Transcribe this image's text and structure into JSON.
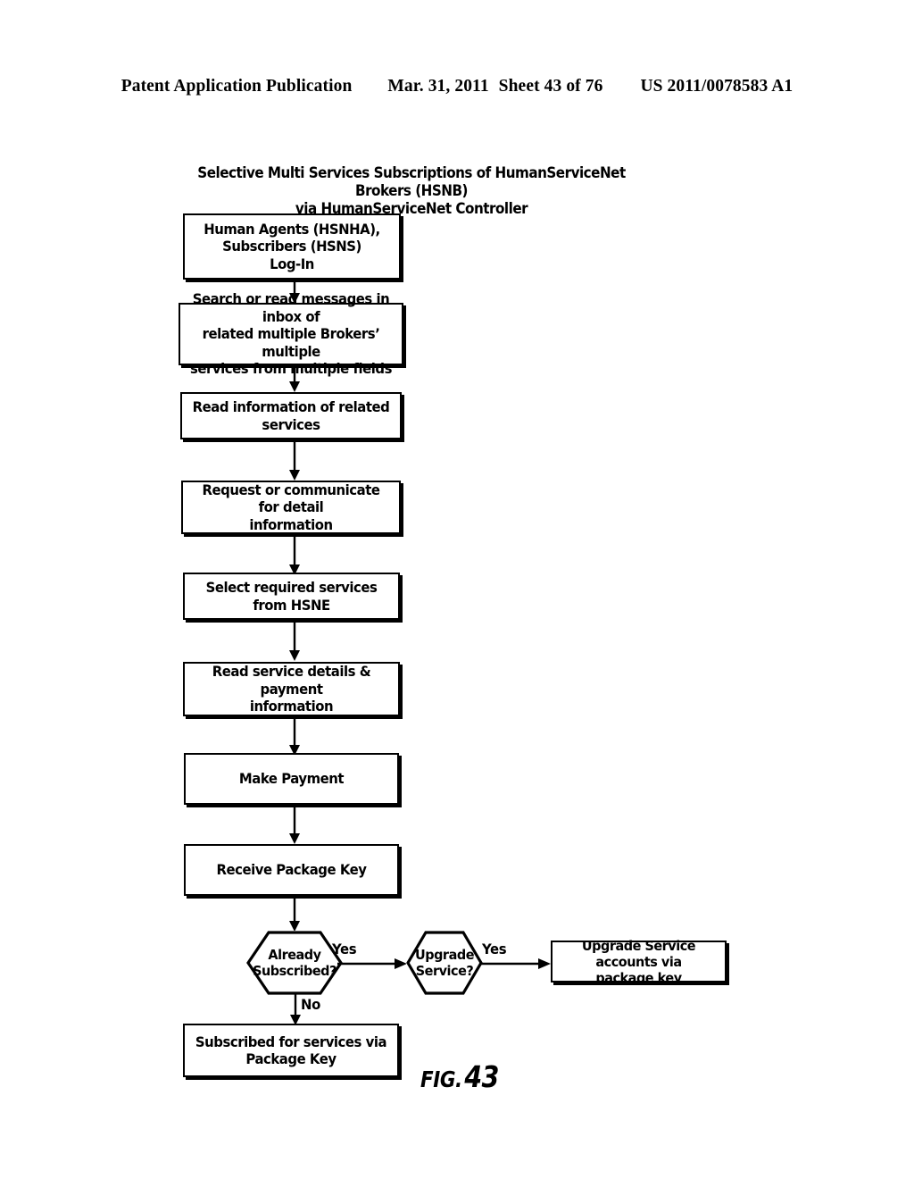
{
  "header": {
    "publication": "Patent Application Publication",
    "date": "Mar. 31, 2011",
    "sheet": "Sheet 43 of 76",
    "number": "US 2011/0078583 A1"
  },
  "figure": {
    "caption_word": "FIG.",
    "caption_number": "43",
    "title_line1": "Selective Multi Services Subscriptions of HumanServiceNet Brokers (HSNB)",
    "title_line2": "via HumanServiceNet Controller",
    "nodes": [
      {
        "id": "login",
        "type": "process",
        "lines": [
          "Human Agents (HSNHA),",
          "Subscribers (HSNS)",
          "Log-In"
        ]
      },
      {
        "id": "search-inbox",
        "type": "process",
        "lines": [
          "Search or read messages in inbox of",
          "related multiple Brokers’ multiple",
          "services from multiple fields"
        ]
      },
      {
        "id": "read-info",
        "type": "process",
        "lines": [
          "Read information of related services"
        ]
      },
      {
        "id": "request-detail",
        "type": "process",
        "lines": [
          "Request or communicate for detail",
          "information"
        ]
      },
      {
        "id": "select-services",
        "type": "process",
        "lines": [
          "Select required services from HSNE"
        ]
      },
      {
        "id": "read-payment",
        "type": "process",
        "lines": [
          "Read service details & payment",
          "information"
        ]
      },
      {
        "id": "make-payment",
        "type": "process",
        "lines": [
          "Make Payment"
        ]
      },
      {
        "id": "receive-key",
        "type": "process",
        "lines": [
          "Receive Package Key"
        ]
      },
      {
        "id": "already-subscribed",
        "type": "decision",
        "lines": [
          "Already",
          "Subscribed?"
        ]
      },
      {
        "id": "upgrade-service",
        "type": "decision",
        "lines": [
          "Upgrade",
          "Service?"
        ]
      },
      {
        "id": "upgrade-accounts",
        "type": "process",
        "lines": [
          "Upgrade Service accounts via",
          "package key"
        ]
      },
      {
        "id": "subscribed-via-key",
        "type": "process",
        "lines": [
          "Subscribed for services via",
          "Package Key"
        ]
      }
    ],
    "edge_labels": {
      "already_subscribed_yes": "Yes",
      "already_subscribed_no": "No",
      "upgrade_service_yes": "Yes"
    },
    "colors": {
      "ink": "#000000",
      "paper": "#ffffff"
    }
  }
}
